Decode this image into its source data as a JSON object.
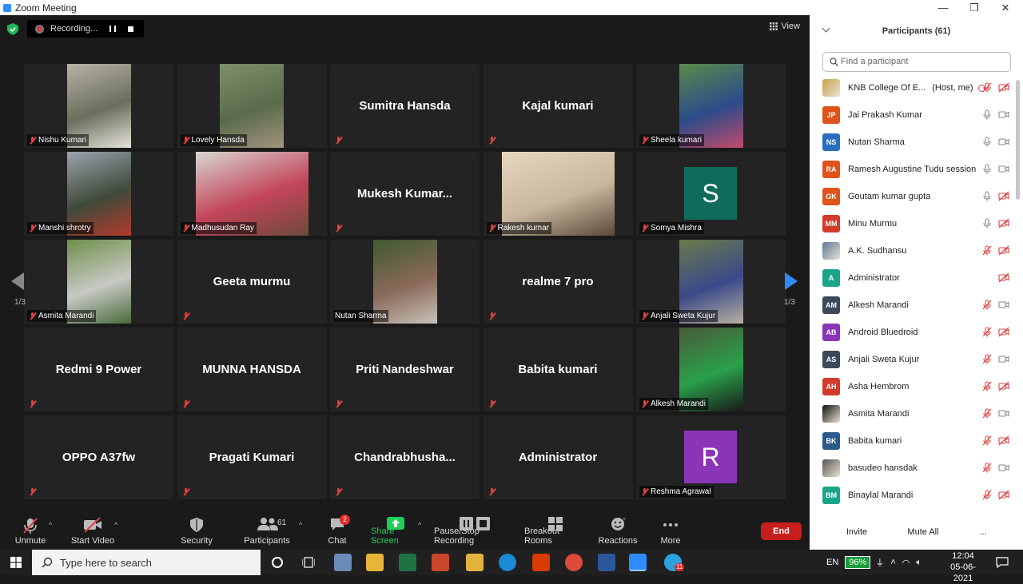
{
  "window": {
    "title": "Zoom Meeting",
    "minimize": "—",
    "maximize": "❐",
    "close": "✕"
  },
  "recording": {
    "label": "Recording..."
  },
  "view": {
    "label": "View"
  },
  "pager": {
    "left": "1/3",
    "right": "1/3"
  },
  "tiles": [
    {
      "label": "Nishu Kumari",
      "video": true,
      "colors": [
        "#b8b3a8",
        "#6a6e5c",
        "#e8e4dc"
      ]
    },
    {
      "label": "Lovely Hansda",
      "video": true,
      "colors": [
        "#7d8f6a",
        "#5a6b4c",
        "#a39480"
      ]
    },
    {
      "label": "",
      "name": "Sumitra Hansda",
      "video": false
    },
    {
      "label": "",
      "name": "Kajal kumari",
      "video": false
    },
    {
      "label": "Sheela kumari",
      "video": true,
      "colors": [
        "#5b8a4a",
        "#2c4b8a",
        "#c24a6a"
      ]
    },
    {
      "label": "Manshi shrotry",
      "video": true,
      "colors": [
        "#9aa3ad",
        "#3f4a3a",
        "#b33a2c"
      ]
    },
    {
      "label": "Madhusudan Ray",
      "video": true,
      "colors": [
        "#d8d6d2",
        "#c2455a",
        "#6e4a3a"
      ]
    },
    {
      "label": "",
      "name": "Mukesh  Kumar...",
      "video": false
    },
    {
      "label": "Rakesh kumar",
      "video": true,
      "colors": [
        "#e6d7c2",
        "#c9b79e",
        "#5a4a3a"
      ]
    },
    {
      "label": "Somya Mishra",
      "video": false,
      "avatar": "S",
      "avatarColor": "#0f6b5c"
    },
    {
      "label": "Asmita Marandi",
      "video": true,
      "colors": [
        "#6f8f4a",
        "#c7c9c4",
        "#4a6a3a"
      ]
    },
    {
      "label": "",
      "name": "Geeta murmu",
      "video": false
    },
    {
      "label": "Nutan Sharma",
      "video": true,
      "colors": [
        "#3e5a30",
        "#8a6a5a",
        "#c8c2b8"
      ],
      "muted": false
    },
    {
      "label": "",
      "name": "realme 7 pro",
      "video": false
    },
    {
      "label": "Anjali Sweta Kujur",
      "video": true,
      "colors": [
        "#6a7a4a",
        "#3a4a8a",
        "#b8b0a0"
      ]
    },
    {
      "label": "",
      "name": "Redmi 9 Power",
      "video": false
    },
    {
      "label": "",
      "name": "MUNNA HANSDA",
      "video": false
    },
    {
      "label": "",
      "name": "Priti Nandeshwar",
      "video": false
    },
    {
      "label": "",
      "name": "Babita kumari",
      "video": false
    },
    {
      "label": "Alkesh Marandi",
      "video": true,
      "colors": [
        "#4a5a3a",
        "#2aa04a",
        "#1a1a1a"
      ]
    },
    {
      "label": "",
      "name": "OPPO A37fw",
      "video": false
    },
    {
      "label": "",
      "name": "Pragati Kumari",
      "video": false
    },
    {
      "label": "",
      "name": "Chandrabhusha...",
      "video": false
    },
    {
      "label": "",
      "name": "Administrator",
      "video": false
    },
    {
      "label": "Reshma Agrawal",
      "video": false,
      "avatar": "R",
      "avatarColor": "#8a35b8"
    }
  ],
  "toolbar": {
    "unmute": "Unmute",
    "start_video": "Start Video",
    "security": "Security",
    "participants": "Participants",
    "participants_count": "61",
    "chat": "Chat",
    "chat_badge": "2",
    "share": "Share Screen",
    "record": "Pause/Stop Recording",
    "breakout": "Breakout Rooms",
    "reactions": "Reactions",
    "more": "More",
    "end": "End"
  },
  "panel": {
    "title": "Participants (61)",
    "search_placeholder": "Find a participant",
    "invite": "Invite",
    "mute_all": "Mute All",
    "more": "...",
    "participants": [
      {
        "initials": "",
        "name": "KNB College Of E...",
        "extra": "(Host, me)",
        "color": "#c9a24a",
        "mic": "off",
        "vid": "off",
        "photo": true
      },
      {
        "initials": "JP",
        "name": "Jai Prakash Kumar",
        "color": "#e0531a",
        "mic": "on",
        "vid": "on"
      },
      {
        "initials": "NS",
        "name": "Nutan Sharma",
        "color": "#2a6ec2",
        "mic": "on",
        "vid": "on"
      },
      {
        "initials": "RA",
        "name": "Ramesh Augustine Tudu session ...",
        "color": "#e0531a",
        "mic": "on",
        "vid": "on"
      },
      {
        "initials": "GK",
        "name": "Goutam kumar gupta",
        "color": "#e0531a",
        "mic": "on",
        "vid": "off"
      },
      {
        "initials": "MM",
        "name": "Minu Murmu",
        "color": "#d43a2a",
        "mic": "on",
        "vid": "off"
      },
      {
        "initials": "",
        "name": "A.K. Sudhansu",
        "color": "#5a7a9a",
        "mic": "off",
        "vid": "off",
        "photo": true
      },
      {
        "initials": "A",
        "name": "Administrator",
        "color": "#1aa58a",
        "mic": "",
        "vid": "off"
      },
      {
        "initials": "AM",
        "name": "Alkesh Marandi",
        "color": "#3a4a5a",
        "mic": "off",
        "vid": "on"
      },
      {
        "initials": "AB",
        "name": "Android Bluedroid",
        "color": "#8a35b8",
        "mic": "off",
        "vid": "off"
      },
      {
        "initials": "AS",
        "name": "Anjali Sweta Kujur",
        "color": "#3a4a5a",
        "mic": "off",
        "vid": "on"
      },
      {
        "initials": "AH",
        "name": "Asha Hembrom",
        "color": "#d43a2a",
        "mic": "off",
        "vid": "off"
      },
      {
        "initials": "",
        "name": "Asmita Marandi",
        "color": "#111111",
        "mic": "off",
        "vid": "on",
        "photo": true
      },
      {
        "initials": "BK",
        "name": "Babita kumari",
        "color": "#2a5a8a",
        "mic": "off",
        "vid": "off"
      },
      {
        "initials": "",
        "name": "basudeo hansdak",
        "color": "#555555",
        "mic": "off",
        "vid": "on",
        "photo": true
      },
      {
        "initials": "BM",
        "name": "Binaylal Marandi",
        "color": "#1aa58a",
        "mic": "off",
        "vid": "off"
      }
    ]
  },
  "taskbar": {
    "search_placeholder": "Type here to search",
    "lang": "EN",
    "battery": "96%",
    "time": "12:04",
    "date": "05-06-2021",
    "zoom_badge": "11"
  }
}
